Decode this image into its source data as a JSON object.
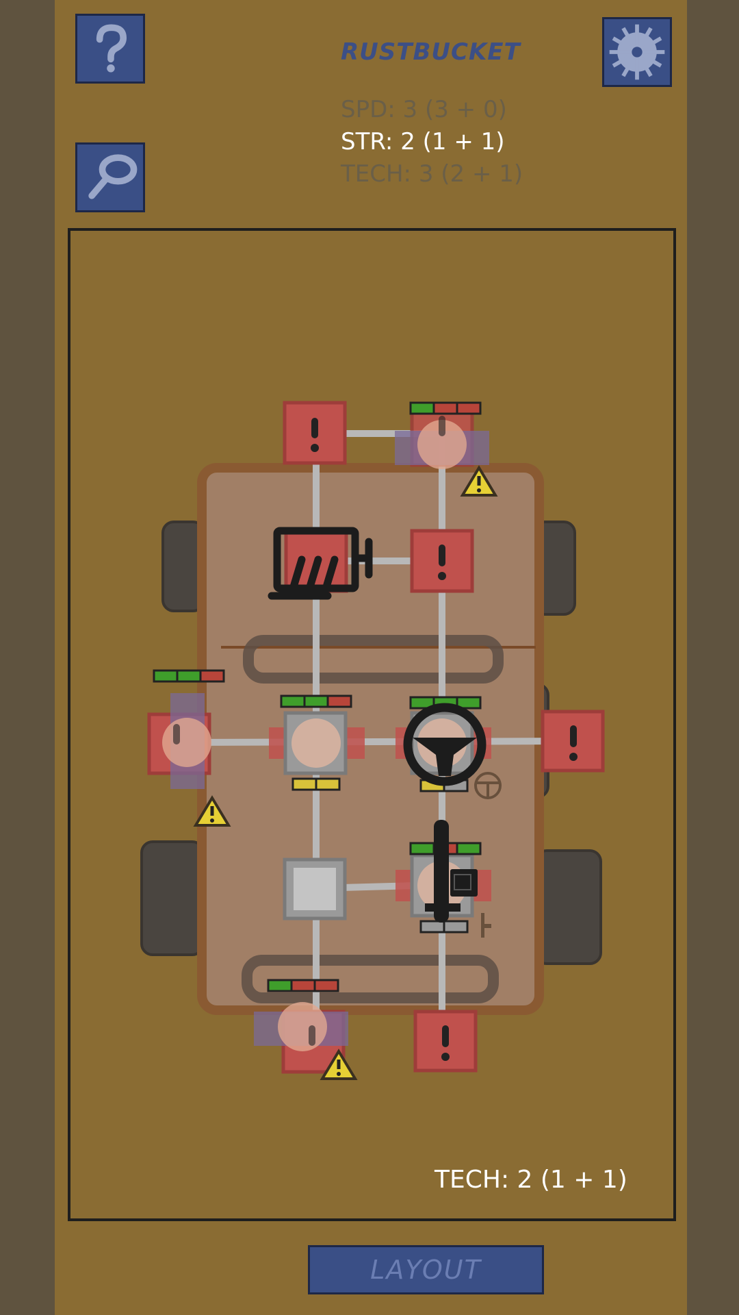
{
  "header": {
    "vehicle_name": "RUSTBUCKET",
    "help_icon": "help-icon",
    "settings_icon": "gear-icon",
    "inspect_icon": "magnifier-icon"
  },
  "stats": [
    {
      "id": "spd",
      "text": "SPD: 3 (3 + 0)",
      "active": false
    },
    {
      "id": "str",
      "text": "STR: 2 (1 + 1)",
      "active": true
    },
    {
      "id": "tech",
      "text": "TECH: 3 (2 + 1)",
      "active": false
    }
  ],
  "board": {
    "tooltip": "TECH: 2 (1 + 1)",
    "slot_icons": [
      "alert-icon",
      "warning-icon",
      "seat-icon",
      "steering-wheel-icon",
      "lever-icon"
    ],
    "colors": {
      "slot_red": "#c0514d",
      "slot_grey": "#9a9a9a",
      "link": "#b8b8b8",
      "chassis": "#a17f66",
      "warning": "#e6d035",
      "gauge_green": "#3f9e2b",
      "gauge_red": "#b8453a",
      "gauge_yellow": "#d8c23a"
    }
  },
  "footer": {
    "layout_label": "LAYOUT"
  }
}
